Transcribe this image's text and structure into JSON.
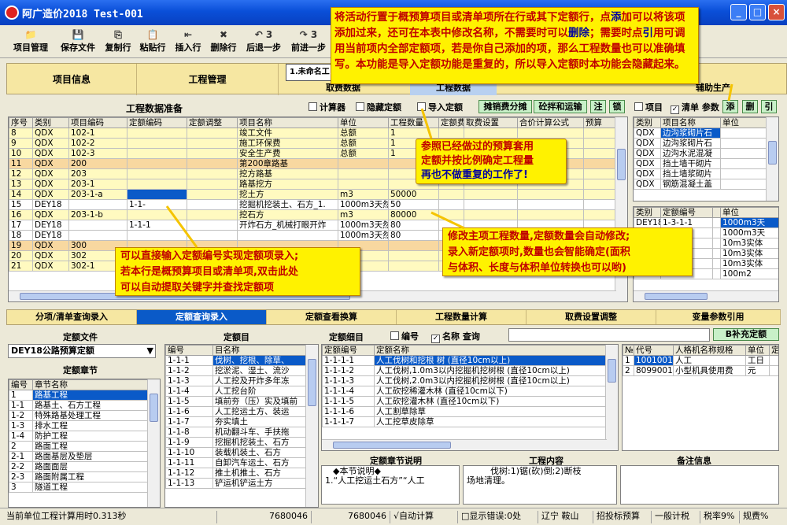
{
  "window": {
    "title": "阿广造价2018 Test-001",
    "min": "_",
    "max": "□",
    "close": "×"
  },
  "toolbar": {
    "items": [
      {
        "label": "项目管理",
        "icon": "📁"
      },
      {
        "label": "保存文件",
        "icon": "💾"
      },
      {
        "label": "复制行",
        "icon": "⎘"
      },
      {
        "label": "粘贴行",
        "icon": "📋"
      },
      {
        "label": "插入行",
        "icon": "⇤"
      },
      {
        "label": "删除行",
        "icon": "✖"
      },
      {
        "label": "后退一步",
        "icon": "↶ 3"
      },
      {
        "label": "前进一步",
        "icon": "↷ 3"
      }
    ]
  },
  "ribbon": {
    "tabs": [
      "项目信息",
      "工程管理"
    ],
    "project_tab": "1.未命名工",
    "sub_tabs": [
      "取费数据",
      "工程数据",
      "辅助生产"
    ]
  },
  "data_prep": {
    "title": "工程数据准备",
    "checks": [
      {
        "label": "计算器",
        "checked": false
      },
      {
        "label": "隐藏定额",
        "checked": false
      },
      {
        "label": "导入定额",
        "checked": false
      }
    ],
    "buttons": [
      "摊销费分摊",
      "砼拌和运输",
      "注",
      "锁"
    ],
    "right_checks": [
      {
        "label": "项目",
        "checked": false
      },
      {
        "label": "清单",
        "checked": true
      }
    ],
    "right_buttons": [
      "添",
      "删",
      "引"
    ],
    "right_label": "参数"
  },
  "main_table": {
    "headers": [
      "序号",
      "类别",
      "项目编码",
      "定额编码",
      "定额调整",
      "项目名称",
      "单位",
      "工程数量",
      "定额费号",
      "取费设置",
      "合价计算公式",
      "预算"
    ],
    "rows": [
      {
        "c": [
          "8",
          "QDX",
          "102-1",
          "",
          "",
          "竣工文件",
          "总额",
          "1",
          "",
          "",
          "",
          ""
        ],
        "s": "y"
      },
      {
        "c": [
          "9",
          "QDX",
          "102-2",
          "",
          "",
          "施工环保费",
          "总额",
          "1",
          "",
          "",
          "",
          ""
        ],
        "s": "y"
      },
      {
        "c": [
          "10",
          "QDX",
          "102-3",
          "",
          "",
          "安全生产费",
          "总额",
          "1",
          "",
          "",
          "基数}×",
          ""
        ],
        "s": "y"
      },
      {
        "c": [
          "11",
          "QDX",
          "200",
          "",
          "",
          "第200章路基",
          "",
          "",
          "",
          "",
          "",
          ""
        ],
        "s": "o"
      },
      {
        "c": [
          "12",
          "QDX",
          "203",
          "",
          "",
          "挖方路基",
          "",
          "",
          "",
          "",
          "",
          ""
        ],
        "s": "y"
      },
      {
        "c": [
          "13",
          "QDX",
          "203-1",
          "",
          "",
          "路基挖方",
          "",
          "",
          "",
          "",
          "",
          ""
        ],
        "s": "y"
      },
      {
        "c": [
          "14",
          "QDX",
          "203-1-a",
          "",
          "",
          "挖土方",
          "m3",
          "50000",
          "",
          "",
          "",
          ""
        ],
        "s": "y",
        "selcol": 3
      },
      {
        "c": [
          "15",
          "DEY18",
          "",
          "1-1-",
          "",
          "挖掘机挖装土、石方_1.",
          "1000m3天然",
          "50",
          "",
          "",
          "",
          ""
        ],
        "s": ""
      },
      {
        "c": [
          "16",
          "QDX",
          "203-1-b",
          "",
          "",
          "挖石方",
          "m3",
          "80000",
          "",
          "",
          "",
          ""
        ],
        "s": "y"
      },
      {
        "c": [
          "17",
          "DEY18",
          "",
          "1-1-1",
          "",
          "开炸石方_机械打眼开炸",
          "1000m3天然",
          "80",
          "",
          "",
          "",
          ""
        ],
        "s": ""
      },
      {
        "c": [
          "18",
          "DEY18",
          "",
          "",
          "",
          "",
          "1000m3天然",
          "80",
          "",
          "",
          "",
          ""
        ],
        "s": ""
      },
      {
        "c": [
          "19",
          "QDX",
          "300",
          "",
          "",
          "",
          "",
          "",
          "",
          "",
          "",
          ""
        ],
        "s": "o"
      },
      {
        "c": [
          "20",
          "QDX",
          "302",
          "",
          "",
          "",
          "",
          "",
          "",
          "",
          "",
          ""
        ],
        "s": "y"
      },
      {
        "c": [
          "21",
          "QDX",
          "302-1",
          "",
          "",
          "",
          "",
          "",
          "",
          "",
          "",
          ""
        ],
        "s": "y"
      }
    ]
  },
  "right_top_table": {
    "headers": [
      "类别",
      "项目名称",
      "单位"
    ],
    "rows": [
      [
        "QDX",
        "边沟浆砌片石",
        ""
      ],
      [
        "QDX",
        "边沟浆砌片石",
        ""
      ],
      [
        "QDX",
        "边沟水泥混凝",
        ""
      ],
      [
        "QDX",
        "挡土墙干砌片",
        ""
      ],
      [
        "QDX",
        "挡土墙浆砌片",
        ""
      ],
      [
        "QDX",
        "钢筋混凝土盖",
        ""
      ]
    ]
  },
  "right_mid_table": {
    "headers": [
      "类别",
      "定额编号",
      "",
      "单位"
    ],
    "rows": [
      [
        "DEY18",
        "1-3-1-1",
        "",
        "1000m3天"
      ],
      [
        "",
        "",
        "",
        "1000m3天"
      ],
      [
        "",
        "",
        "",
        "10m3实体"
      ],
      [
        "",
        "",
        "",
        "10m3实体"
      ],
      [
        "",
        "",
        "",
        "10m3实体"
      ],
      [
        "",
        "-17",
        "",
        "100m2"
      ]
    ]
  },
  "lower_tabs": [
    "分项/清单查询录入",
    "定额查询录入",
    "定额查看换算",
    "工程数量计算",
    "取费设置调整",
    "变量参数引用"
  ],
  "quota_panel": {
    "file_label": "定额文件",
    "file_value": "DEY18公路预算定额",
    "chapter_label": "定额章节",
    "chapter_headers": [
      "编号",
      "章节名称"
    ],
    "chapters": [
      [
        "1",
        "路基工程"
      ],
      [
        "1-1",
        "  路基土、石方工程"
      ],
      [
        "1-2",
        "  特殊路基处理工程"
      ],
      [
        "1-3",
        "  排水工程"
      ],
      [
        "1-4",
        "  防护工程"
      ],
      [
        "2",
        "路面工程"
      ],
      [
        "2-1",
        "  路面基层及垫层"
      ],
      [
        "2-2",
        "  路面面层"
      ],
      [
        "2-3",
        "  路面附属工程"
      ],
      [
        "3",
        "隧道工程"
      ]
    ]
  },
  "quota_dir": {
    "label": "定额目",
    "headers": [
      "编号",
      "目名称"
    ],
    "rows": [
      [
        "1-1-1",
        "伐树、挖根、除草、"
      ],
      [
        "1-1-2",
        "挖淤泥、湿土、流沙"
      ],
      [
        "1-1-3",
        "人工挖及开炸多年冻"
      ],
      [
        "1-1-4",
        "人工挖台阶"
      ],
      [
        "1-1-5",
        "填前夯（压）实及填前"
      ],
      [
        "1-1-6",
        "人工挖运土方、装运"
      ],
      [
        "1-1-7",
        "夯实填土"
      ],
      [
        "1-1-8",
        "机动翻斗车、手扶拖"
      ],
      [
        "1-1-9",
        "挖掘机挖装土、石方"
      ],
      [
        "1-1-10",
        "装载机装土、石方"
      ],
      [
        "1-1-11",
        "自卸汽车运土、石方"
      ],
      [
        "1-1-12",
        "推土机推土、石方"
      ],
      [
        "1-1-13",
        "铲运机铲运土方"
      ]
    ]
  },
  "quota_detail": {
    "label": "定额细目",
    "check_code": "编号",
    "check_name": "名称",
    "query": "查询",
    "search_value": "",
    "add_button": "B补充定额",
    "headers": [
      "定额编号",
      "定额名称"
    ],
    "rows": [
      [
        "1-1-1-1",
        "人工伐树和挖根 树 (直径10cm以上)"
      ],
      [
        "1-1-1-2",
        "人工伐树,1.0m3以内挖掘机挖树根 (直径10cm以上)"
      ],
      [
        "1-1-1-3",
        "人工伐树,2.0m3以内挖掘机挖树根 (直径10cm以上)"
      ],
      [
        "1-1-1-4",
        "人工砍挖稀灌木林 (直径10cm以下)"
      ],
      [
        "1-1-1-5",
        "人工砍挖灌木林 (直径10cm以下)"
      ],
      [
        "1-1-1-6",
        "人工割草除草"
      ],
      [
        "1-1-1-7",
        "人工挖草皮除草"
      ]
    ]
  },
  "res_table": {
    "headers": [
      "№",
      "代号",
      "人格机名称规格",
      "单位",
      "定"
    ],
    "rows": [
      [
        "1",
        "1001001",
        "人工",
        "工日",
        ""
      ],
      [
        "2",
        "8099001",
        "小型机具使用费",
        "元",
        ""
      ]
    ]
  },
  "bottom": {
    "chapter_note_label": "定额章节说明",
    "chapter_note_1": "◆本节说明◆",
    "chapter_note_2": "1.“人工挖运土石方”“人工",
    "work_label": "工程内容",
    "work_1": "伐树:1)锯(砍)倒;2)断枝",
    "work_2": "场地清理。",
    "remark_label": "备注信息"
  },
  "status": {
    "items": [
      "当前单位工程计算用时0.313秒",
      "7680046",
      "7680046",
      "√自动计算",
      "□显示错误:0处",
      "辽宁 鞍山",
      "招投标预算",
      "一般计税",
      "税率9%",
      "规费%"
    ]
  },
  "notes": {
    "n1": [
      "将活动行置于概预算项目或清单项所在行或其下定额行，点",
      "添",
      "加可以将该项添加过来，还可在本表中修改名称，不需要时可",
      "以",
      "删除",
      "；需要时点",
      "引",
      "用可调用当前项内全部定额项，若是你自己添加的项，那么工程数量也可以准确填写。本功能是导入定额功能是重复的，所以导入定额时本功能会隐藏起来。"
    ],
    "n2": [
      "参照已经做过的预算套用",
      "定额并按比例确定工程量",
      "再也不做重复的工作了!"
    ],
    "n3": [
      "修改主项工程数量,定额数量会自动修改;",
      "录入新定额项时,数量也会智能确定(面积",
      "与体积、长度与体积单位转换也可以哟)"
    ],
    "n4": [
      "可以直接输入定额编号实现定额项录入;",
      "若本行是概预算项目或清单项,双击此处",
      "可以自动提取关键字并查找定额项"
    ]
  }
}
